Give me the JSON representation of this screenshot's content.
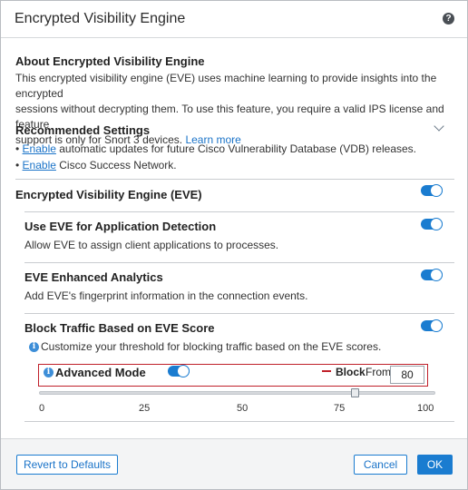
{
  "dialog": {
    "title": "Encrypted Visibility Engine",
    "help_icon": "question-circle-icon"
  },
  "about": {
    "heading": "About Encrypted Visibility Engine",
    "line1": "This encrypted visibility engine (EVE) uses machine learning to provide insights into the encrypted",
    "line2": "sessions without decrypting them. To use this feature, you require a valid IPS license and feature",
    "line3": "support is only for Snort 3 devices.",
    "learn_more": "Learn more"
  },
  "recommended": {
    "heading": "Recommended Settings",
    "chevron_icon": "chevron-down-icon",
    "items": [
      {
        "bullet": "•",
        "link": "Enable",
        "text": " automatic updates for future Cisco Vulnerability Database (VDB) releases."
      },
      {
        "bullet": "•",
        "link": "Enable",
        "text": " Cisco Success Network."
      }
    ]
  },
  "eve": {
    "label": "Encrypted Visibility Engine (EVE)",
    "enabled": true
  },
  "app_detection": {
    "label": "Use EVE for Application Detection",
    "description": "Allow EVE to assign client applications to processes.",
    "enabled": true
  },
  "enhanced_analytics": {
    "label": "EVE Enhanced Analytics",
    "description": "Add EVE's fingerprint information in the connection events.",
    "enabled": true
  },
  "block_traffic": {
    "label": "Block Traffic Based on EVE Score",
    "info": "Customize your threshold for blocking traffic based on the EVE scores.",
    "enabled": true,
    "advanced_mode_label": "Advanced Mode",
    "advanced_mode_enabled": true,
    "block_label": "Block",
    "from_label": "From",
    "from_value": "80",
    "slider": {
      "value": 80,
      "min": 0,
      "max": 100,
      "ticks": [
        "0",
        "25",
        "50",
        "75",
        "100"
      ]
    }
  },
  "footer": {
    "revert_label": "Revert to Defaults",
    "cancel_label": "Cancel",
    "ok_label": "OK"
  },
  "colors": {
    "accent": "#1a7cd0",
    "link": "#1a73c8",
    "highlight": "#c0202a"
  }
}
